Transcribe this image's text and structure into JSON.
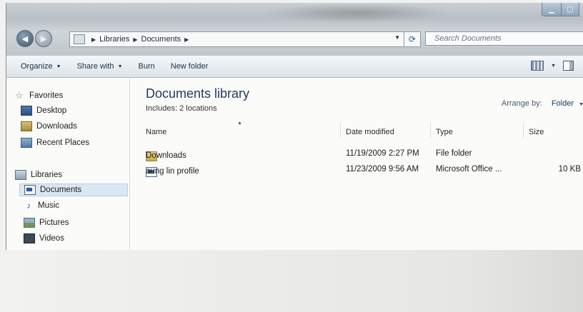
{
  "address": {
    "crumbs": [
      "Libraries",
      "Documents"
    ],
    "search_placeholder": "Search Documents"
  },
  "toolbar": {
    "organize": "Organize",
    "share_with": "Share with",
    "burn": "Burn",
    "new_folder": "New folder"
  },
  "sidebar": {
    "favorites": "Favorites",
    "desktop": "Desktop",
    "downloads": "Downloads",
    "recent_places": "Recent Places",
    "libraries": "Libraries",
    "documents": "Documents",
    "music": "Music",
    "pictures": "Pictures",
    "videos": "Videos"
  },
  "library": {
    "title": "Documents library",
    "includes": "Includes: 2 locations",
    "arrange_label": "Arrange by:",
    "arrange_value": "Folder"
  },
  "columns": {
    "name": "Name",
    "date_modified": "Date modified",
    "type": "Type",
    "size": "Size"
  },
  "files": [
    {
      "name": "Downloads",
      "date": "11/19/2009 2:27 PM",
      "type": "File folder",
      "size": ""
    },
    {
      "name": "aung lin profile",
      "date": "11/23/2009 9:56 AM",
      "type": "Microsoft Office ...",
      "size": "10 KB"
    }
  ]
}
